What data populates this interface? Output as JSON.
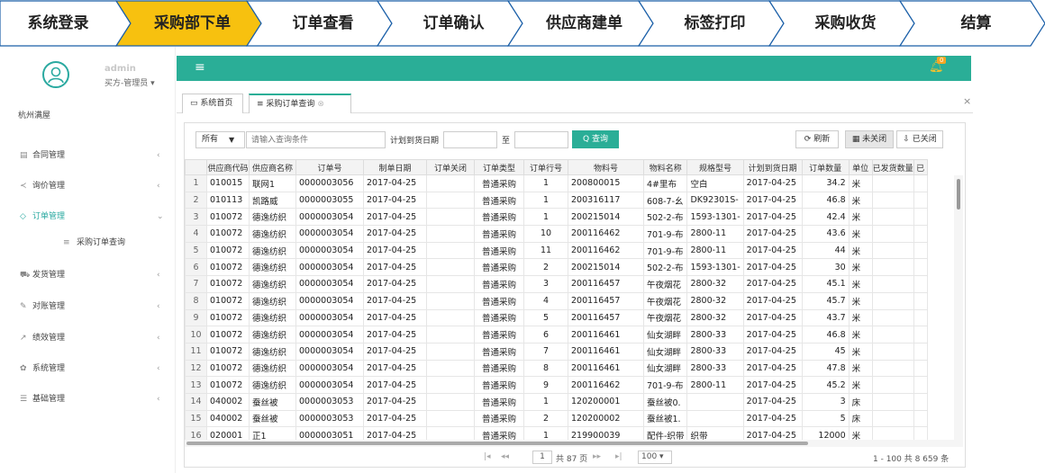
{
  "flow": {
    "steps": [
      "系统登录",
      "采购部下单",
      "订单查看",
      "订单确认",
      "供应商建单",
      "标签打印",
      "采购收货",
      "结算"
    ],
    "active_index": 1,
    "active_color": "#f7c10f"
  },
  "sidebar": {
    "username": "admin",
    "role": "买方-管理员 ▾",
    "org": "杭州满屋",
    "items": [
      {
        "icon": "▤",
        "label": "合同管理"
      },
      {
        "icon": "≺",
        "label": "询价管理"
      },
      {
        "icon": "◇",
        "label": "订单管理"
      },
      {
        "icon": "≡",
        "label": "采购订单查询"
      },
      {
        "icon": "⛟",
        "label": "发货管理"
      },
      {
        "icon": "✎",
        "label": "对账管理"
      },
      {
        "icon": "↗",
        "label": "绩效管理"
      },
      {
        "icon": "✿",
        "label": "系统管理"
      },
      {
        "icon": "☰",
        "label": "基础管理"
      }
    ]
  },
  "topbar": {
    "menu_icon": "≡",
    "bell_count": "0",
    "accent": "#2aae97"
  },
  "tabs": [
    {
      "icon": "▭",
      "label": "系统首页"
    },
    {
      "icon": "≡",
      "label": "采购订单查询",
      "close": "⊗"
    }
  ],
  "close_all": "×",
  "toolbar": {
    "filter_select": "所有",
    "search_placeholder": "请输入查询条件",
    "date_label": "计划到货日期",
    "date_sep": "至",
    "query_btn": "Q 查询",
    "refresh_btn": "⟳ 刷新",
    "unclosed_btn": "▦ 未关闭",
    "closed_btn": "⇩ 已关闭"
  },
  "table": {
    "columns": [
      "",
      "供应商代码",
      "供应商名称",
      "订单号",
      "制单日期",
      "订单关闭",
      "订单类型",
      "订单行号",
      "物料号",
      "物料名称",
      "规格型号",
      "计划到货日期",
      "订单数量",
      "单位",
      "已发货数量",
      "已"
    ],
    "rows": [
      [
        "1",
        "010015",
        "联网1",
        "0000003056",
        "2017-04-25",
        "",
        "普通采购",
        "1",
        "200800015",
        "4#里布",
        "空白",
        "2017-04-25",
        "34.2",
        "米",
        "",
        ""
      ],
      [
        "2",
        "010113",
        "凯路威",
        "0000003055",
        "2017-04-25",
        "",
        "普通采购",
        "1",
        "200316117",
        "608-7-幺",
        "DK92301S-",
        "2017-04-25",
        "46.8",
        "米",
        "",
        ""
      ],
      [
        "3",
        "010072",
        "德逸纺织",
        "0000003054",
        "2017-04-25",
        "",
        "普通采购",
        "1",
        "200215014",
        "502-2-布",
        "1593-1301-",
        "2017-04-25",
        "42.4",
        "米",
        "",
        ""
      ],
      [
        "4",
        "010072",
        "德逸纺织",
        "0000003054",
        "2017-04-25",
        "",
        "普通采购",
        "10",
        "200116462",
        "701-9-布",
        "2800-11",
        "2017-04-25",
        "43.6",
        "米",
        "",
        ""
      ],
      [
        "5",
        "010072",
        "德逸纺织",
        "0000003054",
        "2017-04-25",
        "",
        "普通采购",
        "11",
        "200116462",
        "701-9-布",
        "2800-11",
        "2017-04-25",
        "44",
        "米",
        "",
        ""
      ],
      [
        "6",
        "010072",
        "德逸纺织",
        "0000003054",
        "2017-04-25",
        "",
        "普通采购",
        "2",
        "200215014",
        "502-2-布",
        "1593-1301-",
        "2017-04-25",
        "30",
        "米",
        "",
        ""
      ],
      [
        "7",
        "010072",
        "德逸纺织",
        "0000003054",
        "2017-04-25",
        "",
        "普通采购",
        "3",
        "200116457",
        "午夜烟花",
        "2800-32",
        "2017-04-25",
        "45.1",
        "米",
        "",
        ""
      ],
      [
        "8",
        "010072",
        "德逸纺织",
        "0000003054",
        "2017-04-25",
        "",
        "普通采购",
        "4",
        "200116457",
        "午夜烟花",
        "2800-32",
        "2017-04-25",
        "45.7",
        "米",
        "",
        ""
      ],
      [
        "9",
        "010072",
        "德逸纺织",
        "0000003054",
        "2017-04-25",
        "",
        "普通采购",
        "5",
        "200116457",
        "午夜烟花",
        "2800-32",
        "2017-04-25",
        "43.7",
        "米",
        "",
        ""
      ],
      [
        "10",
        "010072",
        "德逸纺织",
        "0000003054",
        "2017-04-25",
        "",
        "普通采购",
        "6",
        "200116461",
        "仙女湖畔",
        "2800-33",
        "2017-04-25",
        "46.8",
        "米",
        "",
        ""
      ],
      [
        "11",
        "010072",
        "德逸纺织",
        "0000003054",
        "2017-04-25",
        "",
        "普通采购",
        "7",
        "200116461",
        "仙女湖畔",
        "2800-33",
        "2017-04-25",
        "45",
        "米",
        "",
        ""
      ],
      [
        "12",
        "010072",
        "德逸纺织",
        "0000003054",
        "2017-04-25",
        "",
        "普通采购",
        "8",
        "200116461",
        "仙女湖畔",
        "2800-33",
        "2017-04-25",
        "47.8",
        "米",
        "",
        ""
      ],
      [
        "13",
        "010072",
        "德逸纺织",
        "0000003054",
        "2017-04-25",
        "",
        "普通采购",
        "9",
        "200116462",
        "701-9-布",
        "2800-11",
        "2017-04-25",
        "45.2",
        "米",
        "",
        ""
      ],
      [
        "14",
        "040002",
        "蚕丝被",
        "0000003053",
        "2017-04-25",
        "",
        "普通采购",
        "1",
        "120200001",
        "蚕丝被0.",
        "",
        "2017-04-25",
        "3",
        "床",
        "",
        ""
      ],
      [
        "15",
        "040002",
        "蚕丝被",
        "0000003053",
        "2017-04-25",
        "",
        "普通采购",
        "2",
        "120200002",
        "蚕丝被1.",
        "",
        "2017-04-25",
        "5",
        "床",
        "",
        ""
      ],
      [
        "16",
        "020001",
        "正1",
        "0000003051",
        "2017-04-25",
        "",
        "普通采购",
        "1",
        "219900039",
        "配件-织带",
        "织带",
        "2017-04-25",
        "12000",
        "米",
        "",
        ""
      ]
    ]
  },
  "pager": {
    "first": "|◂",
    "prev": "◂◂",
    "page": "1",
    "of_pages": "共 87 页",
    "next": "▸▸",
    "last": "▸|",
    "page_size": "100 ▾",
    "summary": "1 - 100  共 8 659 条"
  }
}
